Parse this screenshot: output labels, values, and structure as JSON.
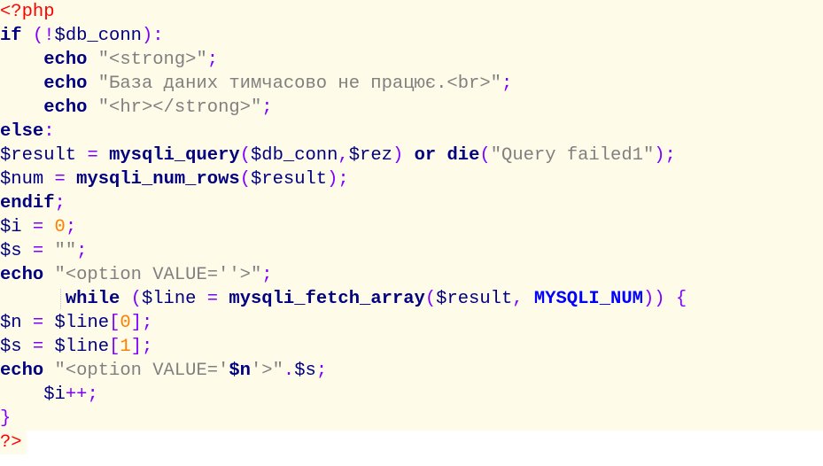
{
  "colors": {
    "background": "#fefbe9",
    "keyword": "#000080",
    "operator": "#8000ff",
    "string": "#808080",
    "number": "#ff8000",
    "php_tag": "#ff0000",
    "constant": "#0000ff"
  },
  "code": {
    "lines": [
      {
        "t": [
          {
            "s": "<?php",
            "c": "tag"
          }
        ]
      },
      {
        "t": [
          {
            "s": "if",
            "c": "kw"
          },
          {
            "s": " "
          },
          {
            "s": "(!",
            "c": "pn"
          },
          {
            "s": "$db_conn",
            "c": "var"
          },
          {
            "s": "):",
            "c": "pn"
          }
        ]
      },
      {
        "t": [
          {
            "s": "    "
          },
          {
            "s": "echo",
            "c": "kw"
          },
          {
            "s": " "
          },
          {
            "s": "\"<strong>\"",
            "c": "str"
          },
          {
            "s": ";",
            "c": "pn"
          }
        ]
      },
      {
        "t": [
          {
            "s": "    "
          },
          {
            "s": "echo",
            "c": "kw"
          },
          {
            "s": " "
          },
          {
            "s": "\"База даних тимчасово не працює.<br>\"",
            "c": "str"
          },
          {
            "s": ";",
            "c": "pn"
          }
        ]
      },
      {
        "t": [
          {
            "s": "    "
          },
          {
            "s": "echo",
            "c": "kw"
          },
          {
            "s": " "
          },
          {
            "s": "\"<hr></strong>\"",
            "c": "str"
          },
          {
            "s": ";",
            "c": "pn"
          }
        ]
      },
      {
        "t": [
          {
            "s": "else",
            "c": "kw"
          },
          {
            "s": ":",
            "c": "pn"
          }
        ]
      },
      {
        "t": [
          {
            "s": "$result",
            "c": "var"
          },
          {
            "s": " "
          },
          {
            "s": "=",
            "c": "op"
          },
          {
            "s": " "
          },
          {
            "s": "mysqli_query",
            "c": "fn"
          },
          {
            "s": "(",
            "c": "pn"
          },
          {
            "s": "$db_conn",
            "c": "var"
          },
          {
            "s": ",",
            "c": "pn"
          },
          {
            "s": "$rez",
            "c": "var"
          },
          {
            "s": ")",
            "c": "pn"
          },
          {
            "s": " "
          },
          {
            "s": "or",
            "c": "kw"
          },
          {
            "s": " "
          },
          {
            "s": "die",
            "c": "kw"
          },
          {
            "s": "(",
            "c": "pn"
          },
          {
            "s": "\"Query failed1\"",
            "c": "str"
          },
          {
            "s": ");",
            "c": "pn"
          }
        ]
      },
      {
        "t": [
          {
            "s": "$num",
            "c": "var"
          },
          {
            "s": " "
          },
          {
            "s": "=",
            "c": "op"
          },
          {
            "s": " "
          },
          {
            "s": "mysqli_num_rows",
            "c": "fn"
          },
          {
            "s": "(",
            "c": "pn"
          },
          {
            "s": "$result",
            "c": "var"
          },
          {
            "s": ");",
            "c": "pn"
          }
        ]
      },
      {
        "t": [
          {
            "s": "endif",
            "c": "kw"
          },
          {
            "s": ";",
            "c": "pn"
          }
        ]
      },
      {
        "t": [
          {
            "s": "$i",
            "c": "var"
          },
          {
            "s": " "
          },
          {
            "s": "=",
            "c": "op"
          },
          {
            "s": " "
          },
          {
            "s": "0",
            "c": "num"
          },
          {
            "s": ";",
            "c": "pn"
          }
        ]
      },
      {
        "t": [
          {
            "s": "$s",
            "c": "var"
          },
          {
            "s": " "
          },
          {
            "s": "=",
            "c": "op"
          },
          {
            "s": " "
          },
          {
            "s": "\"\"",
            "c": "str"
          },
          {
            "s": ";",
            "c": "pn"
          }
        ]
      },
      {
        "t": [
          {
            "s": "echo",
            "c": "kw"
          },
          {
            "s": " "
          },
          {
            "s": "\"<option VALUE=''>\"",
            "c": "str"
          },
          {
            "s": ";",
            "c": "pn"
          }
        ]
      },
      {
        "t": [
          {
            "s": "      "
          },
          {
            "s": "while",
            "c": "kw"
          },
          {
            "s": " "
          },
          {
            "s": "(",
            "c": "pn"
          },
          {
            "s": "$line",
            "c": "var"
          },
          {
            "s": " "
          },
          {
            "s": "=",
            "c": "op"
          },
          {
            "s": " "
          },
          {
            "s": "mysqli_fetch_array",
            "c": "fn"
          },
          {
            "s": "(",
            "c": "pn"
          },
          {
            "s": "$result",
            "c": "var"
          },
          {
            "s": ",",
            "c": "pn"
          },
          {
            "s": " "
          },
          {
            "s": "MYSQLI_NUM",
            "c": "const"
          },
          {
            "s": "))",
            "c": "pn"
          },
          {
            "s": " "
          },
          {
            "s": "{",
            "c": "pn"
          }
        ],
        "guide": true
      },
      {
        "t": [
          {
            "s": "$n",
            "c": "var"
          },
          {
            "s": " "
          },
          {
            "s": "=",
            "c": "op"
          },
          {
            "s": " "
          },
          {
            "s": "$line",
            "c": "var"
          },
          {
            "s": "[",
            "c": "pn"
          },
          {
            "s": "0",
            "c": "num"
          },
          {
            "s": "];",
            "c": "pn"
          }
        ]
      },
      {
        "t": [
          {
            "s": "$s",
            "c": "var"
          },
          {
            "s": " "
          },
          {
            "s": "=",
            "c": "op"
          },
          {
            "s": " "
          },
          {
            "s": "$line",
            "c": "var"
          },
          {
            "s": "[",
            "c": "pn"
          },
          {
            "s": "1",
            "c": "num"
          },
          {
            "s": "];",
            "c": "pn"
          }
        ]
      },
      {
        "t": [
          {
            "s": "echo",
            "c": "kw"
          },
          {
            "s": " "
          },
          {
            "s": "\"<option VALUE='",
            "c": "str"
          },
          {
            "s": "$n",
            "c": "interp"
          },
          {
            "s": "'>\"",
            "c": "str"
          },
          {
            "s": ".",
            "c": "op"
          },
          {
            "s": "$s",
            "c": "var"
          },
          {
            "s": ";",
            "c": "pn"
          }
        ]
      },
      {
        "t": [
          {
            "s": "    "
          },
          {
            "s": "$i",
            "c": "var"
          },
          {
            "s": "++",
            "c": "op"
          },
          {
            "s": ";",
            "c": "pn"
          }
        ]
      },
      {
        "t": [
          {
            "s": "}",
            "c": "pn"
          }
        ]
      },
      {
        "t": [
          {
            "s": "?>",
            "c": "tag"
          }
        ],
        "bg": "short"
      }
    ]
  }
}
